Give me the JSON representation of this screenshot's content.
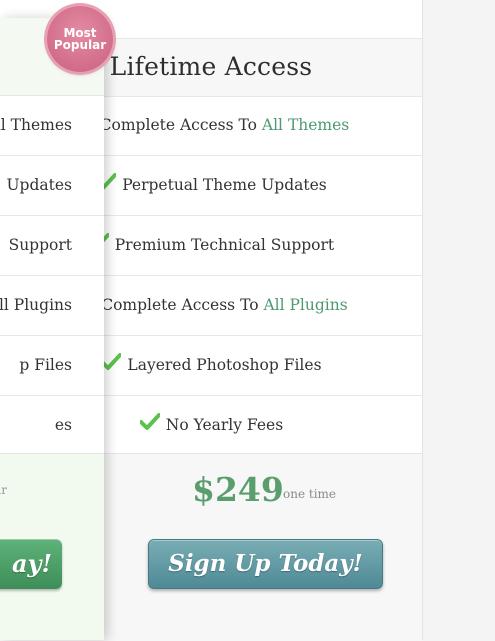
{
  "plan": {
    "title": "Lifetime Access",
    "features": [
      {
        "pre": "Complete Access To ",
        "accent": "All Themes"
      },
      {
        "pre": "Perpetual Theme Updates",
        "accent": ""
      },
      {
        "pre": "Premium Technical Support",
        "accent": ""
      },
      {
        "pre": "Complete Access To ",
        "accent": "All Plugins"
      },
      {
        "pre": "Layered Photoshop Files",
        "accent": ""
      },
      {
        "pre": "No Yearly Fees",
        "accent": ""
      }
    ],
    "price": "$249",
    "price_note": "one time",
    "cta": "Sign Up Today!"
  },
  "popular_plan": {
    "badge_line1": "Most",
    "badge_line2": "Popular",
    "features_visible": [
      "All Themes",
      "Updates",
      "Support",
      "All Plugins",
      "p Files",
      "es"
    ],
    "price_note_fragment": "ar",
    "cta_fragment": "ay!"
  },
  "colors": {
    "accent": "#4d9a72",
    "check": "#5bc24e",
    "badge": "#d36c8a",
    "cta_blue": "#5a949e",
    "cta_green": "#4aa066"
  }
}
